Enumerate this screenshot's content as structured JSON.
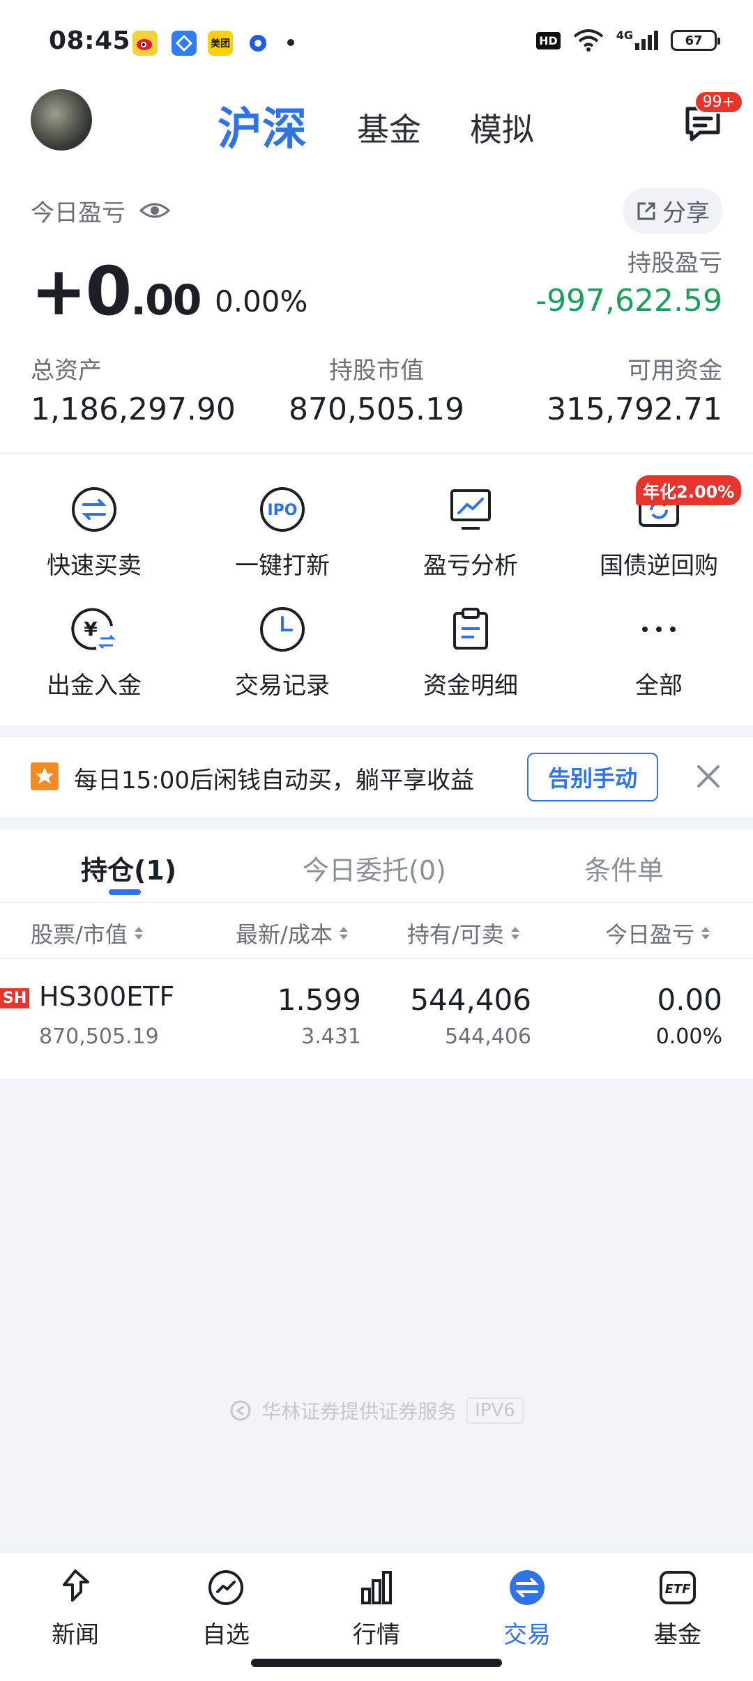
{
  "status_bar": {
    "time": "08:45",
    "notif_meituan": "美团",
    "hd": "HD",
    "network": "4G",
    "battery": "67"
  },
  "header": {
    "tabs": [
      "沪深",
      "基金",
      "模拟"
    ],
    "message_badge": "99+"
  },
  "summary": {
    "today_pnl_label": "今日盈亏",
    "share_label": "分享",
    "today_pnl_int": "+0",
    "today_pnl_dec": ".00",
    "today_pnl_pct": "0.00%",
    "hold_pnl_label": "持股盈亏",
    "hold_pnl_value": "-997,622.59",
    "total_assets_label": "总资产",
    "total_assets_value": "1,186,297.90",
    "market_value_label": "持股市值",
    "market_value_value": "870,505.19",
    "available_label": "可用资金",
    "available_value": "315,792.71"
  },
  "actions": [
    {
      "label": "快速买卖",
      "icon": "swap-icon"
    },
    {
      "label": "一键打新",
      "icon": "ipo-icon"
    },
    {
      "label": "盈亏分析",
      "icon": "chart-monitor-icon"
    },
    {
      "label": "国债逆回购",
      "icon": "repo-icon"
    },
    {
      "label": "出金入金",
      "icon": "yuan-transfer-icon"
    },
    {
      "label": "交易记录",
      "icon": "clock-icon"
    },
    {
      "label": "资金明细",
      "icon": "clipboard-icon"
    },
    {
      "label": "全部",
      "icon": "more-icon"
    }
  ],
  "apr_badge": "年化2.00%",
  "banner": {
    "text": "每日15:00后闲钱自动买，躺平享收益",
    "button": "告别手动"
  },
  "positions": {
    "tabs": [
      "持仓(1)",
      "今日委托(0)",
      "条件单"
    ],
    "columns": [
      "股票/市值",
      "最新/成本",
      "持有/可卖",
      "今日盈亏"
    ],
    "rows": [
      {
        "market": "SH",
        "name": "HS300ETF",
        "market_value": "870,505.19",
        "latest": "1.599",
        "cost": "3.431",
        "hold": "544,406",
        "sellable": "544,406",
        "today_pnl": "0.00",
        "today_pnl_pct": "0.00%"
      }
    ]
  },
  "footer": {
    "note": "华林证券提供证券服务",
    "tag": "IPV6"
  },
  "bottom_nav": [
    {
      "label": "新闻",
      "icon": "news-icon"
    },
    {
      "label": "自选",
      "icon": "watchlist-icon"
    },
    {
      "label": "行情",
      "icon": "market-icon"
    },
    {
      "label": "交易",
      "icon": "trade-icon"
    },
    {
      "label": "基金",
      "icon": "etf-icon"
    }
  ],
  "colors": {
    "accent": "#2f73e4",
    "up": "#e5352f",
    "down": "#1aa05a"
  }
}
